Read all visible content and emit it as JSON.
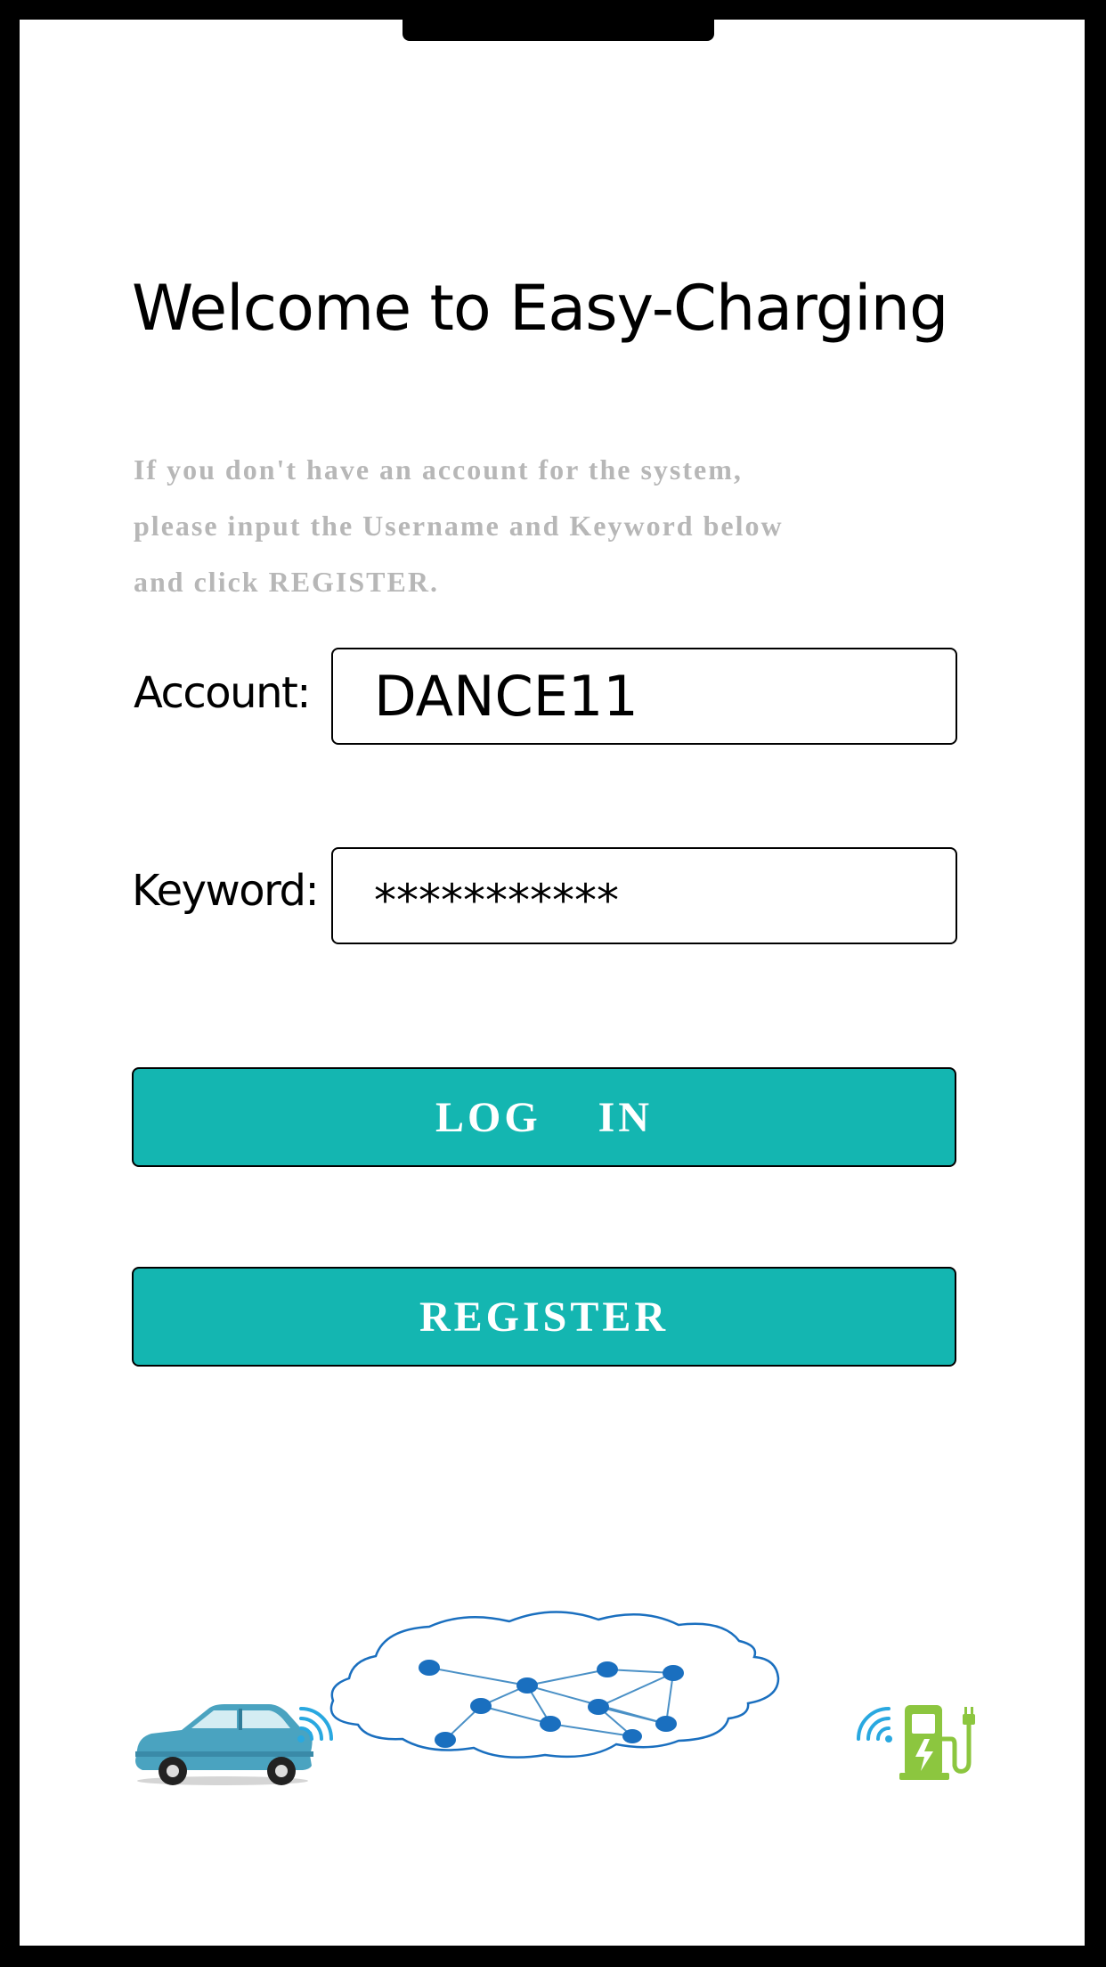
{
  "screen": {
    "title": "Welcome to Easy-Charging",
    "instructions": [
      "If you don't have an account for the system,",
      "please input the Username and Keyword below",
      "and click REGISTER."
    ]
  },
  "form": {
    "account": {
      "label": "Account:",
      "value": "DANCE11"
    },
    "keyword": {
      "label": "Keyword:",
      "value": "***********"
    }
  },
  "buttons": {
    "login": "LOG    IN",
    "register": "REGISTER"
  },
  "illustration": {
    "icons": [
      "car-icon",
      "wifi-signal-icon",
      "network-cloud-icon",
      "charging-station-icon"
    ],
    "colors": {
      "accent": "#14b6b1",
      "network": "#1a6fbf",
      "car": "#4aa3c0",
      "charger": "#8cc63f",
      "signal": "#29a8e0"
    }
  }
}
